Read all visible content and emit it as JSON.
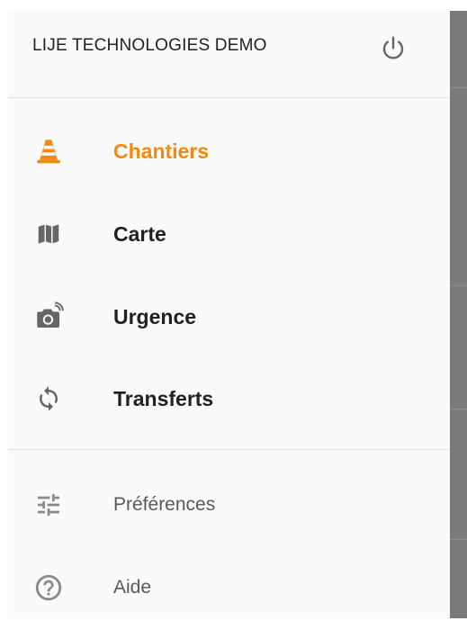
{
  "header": {
    "title": "LIJE TECHNOLOGIES DEMO",
    "power_icon": "power-icon"
  },
  "menu": {
    "main_items": [
      {
        "label": "Chantiers",
        "icon": "traffic-cone-icon",
        "active": true
      },
      {
        "label": "Carte",
        "icon": "map-icon",
        "active": false
      },
      {
        "label": "Urgence",
        "icon": "camera-wireless-icon",
        "active": false
      },
      {
        "label": "Transferts",
        "icon": "sync-icon",
        "active": false
      }
    ],
    "secondary_items": [
      {
        "label": "Préférences",
        "icon": "tune-sliders-icon"
      },
      {
        "label": "Aide",
        "icon": "help-circle-icon"
      }
    ]
  },
  "colors": {
    "accent": "#f08a12",
    "text_primary": "#212121",
    "text_secondary": "#595959",
    "icon_grey": "#666666",
    "drawer_bg": "#fafafa",
    "scrim": "#7a7a7a"
  }
}
